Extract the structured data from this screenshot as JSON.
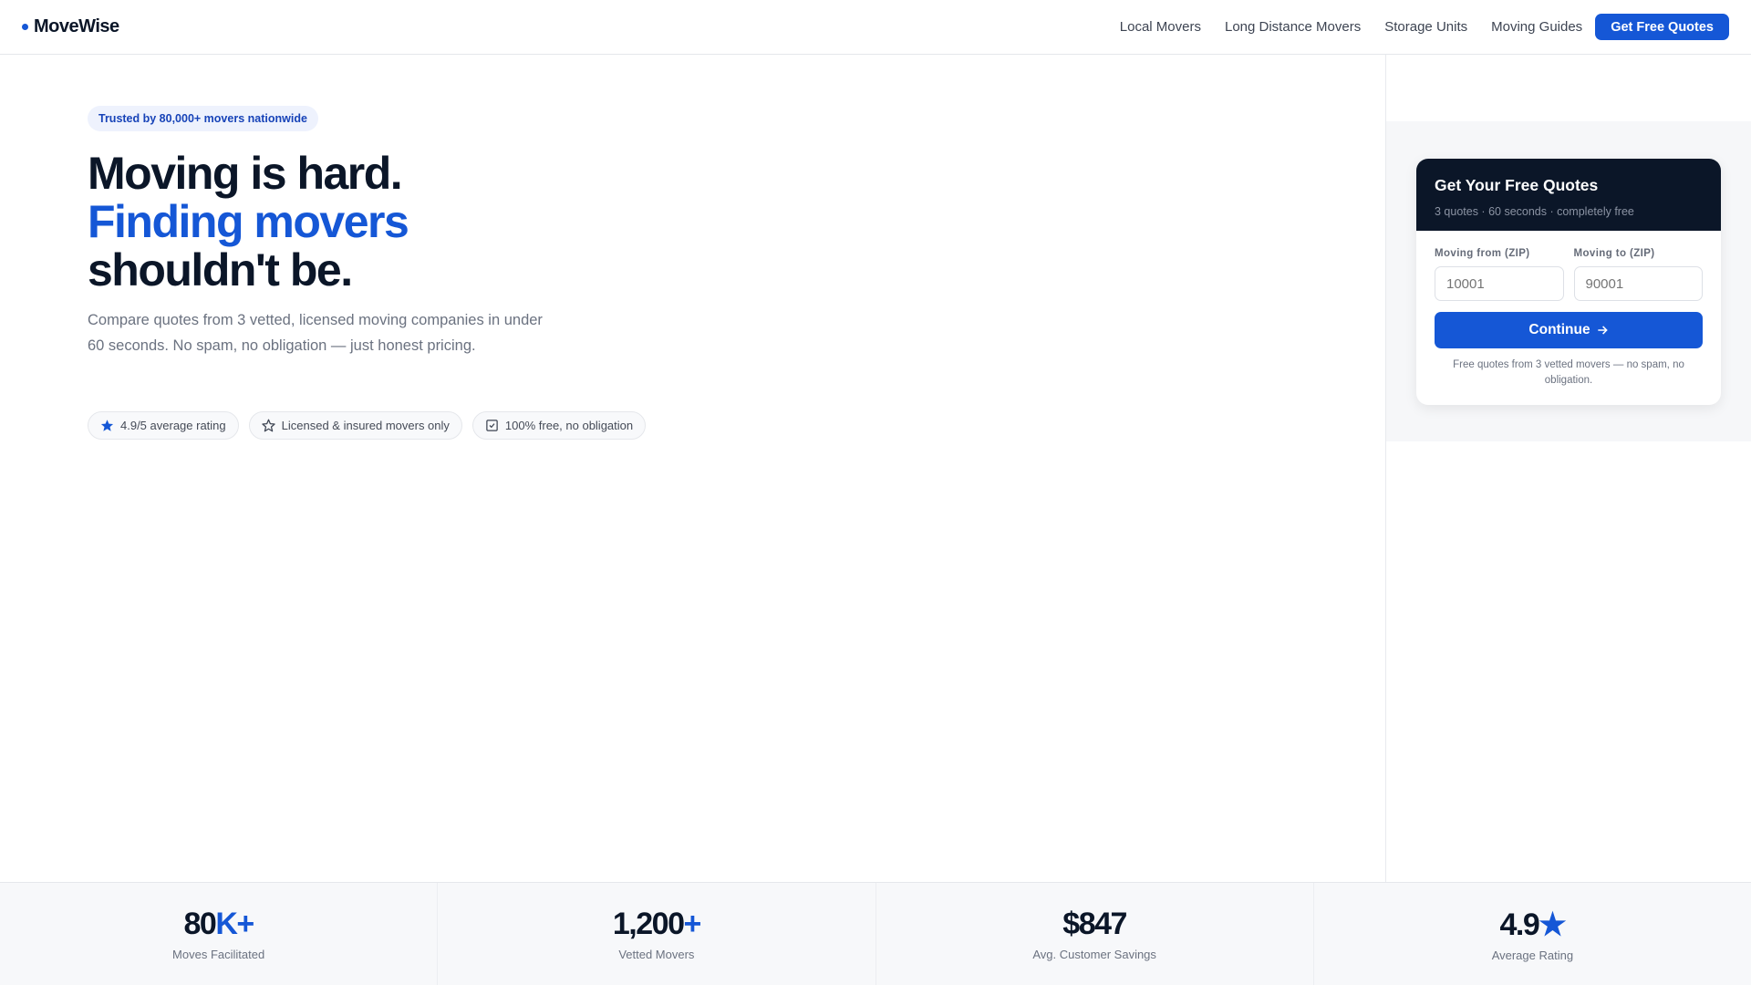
{
  "brand": {
    "name": "MoveWise",
    "accent": "#1557d6",
    "dark": "#0b1628"
  },
  "nav": {
    "links": [
      "Local Movers",
      "Long Distance Movers",
      "Storage Units",
      "Moving Guides"
    ],
    "cta": "Get Free Quotes"
  },
  "hero": {
    "badge": "Trusted by 80,000+ movers nationwide",
    "headline_1": "Moving is hard.",
    "headline_2": "Finding movers",
    "headline_3": "shouldn't be.",
    "subtitle": "Compare quotes from 3 vetted, licensed moving companies in under 60 seconds. No spam, no obligation — just honest pricing.",
    "chips": [
      {
        "icon": "star-filled-icon",
        "label": "4.9/5 average rating"
      },
      {
        "icon": "star-outline-icon",
        "label": "Licensed & insured movers only"
      },
      {
        "icon": "checkbox-icon",
        "label": "100% free, no obligation"
      }
    ]
  },
  "quote_card": {
    "title": "Get Your Free Quotes",
    "subtitle": "3 quotes · 60 seconds · completely free",
    "from_label": "Moving from (ZIP)",
    "from_placeholder": "10001",
    "to_label": "Moving to (ZIP)",
    "to_placeholder": "90001",
    "button": "Continue",
    "note": "Free quotes from 3 vetted movers — no spam, no obligation."
  },
  "stats": [
    {
      "value": "80",
      "accent": "K+",
      "label": "Moves Facilitated"
    },
    {
      "value": "1,200",
      "accent": "+",
      "label": "Vetted Movers"
    },
    {
      "value": "$847",
      "accent": "",
      "label": "Avg. Customer Savings"
    },
    {
      "value": "4.9",
      "accent": "★",
      "label": "Average Rating"
    }
  ]
}
